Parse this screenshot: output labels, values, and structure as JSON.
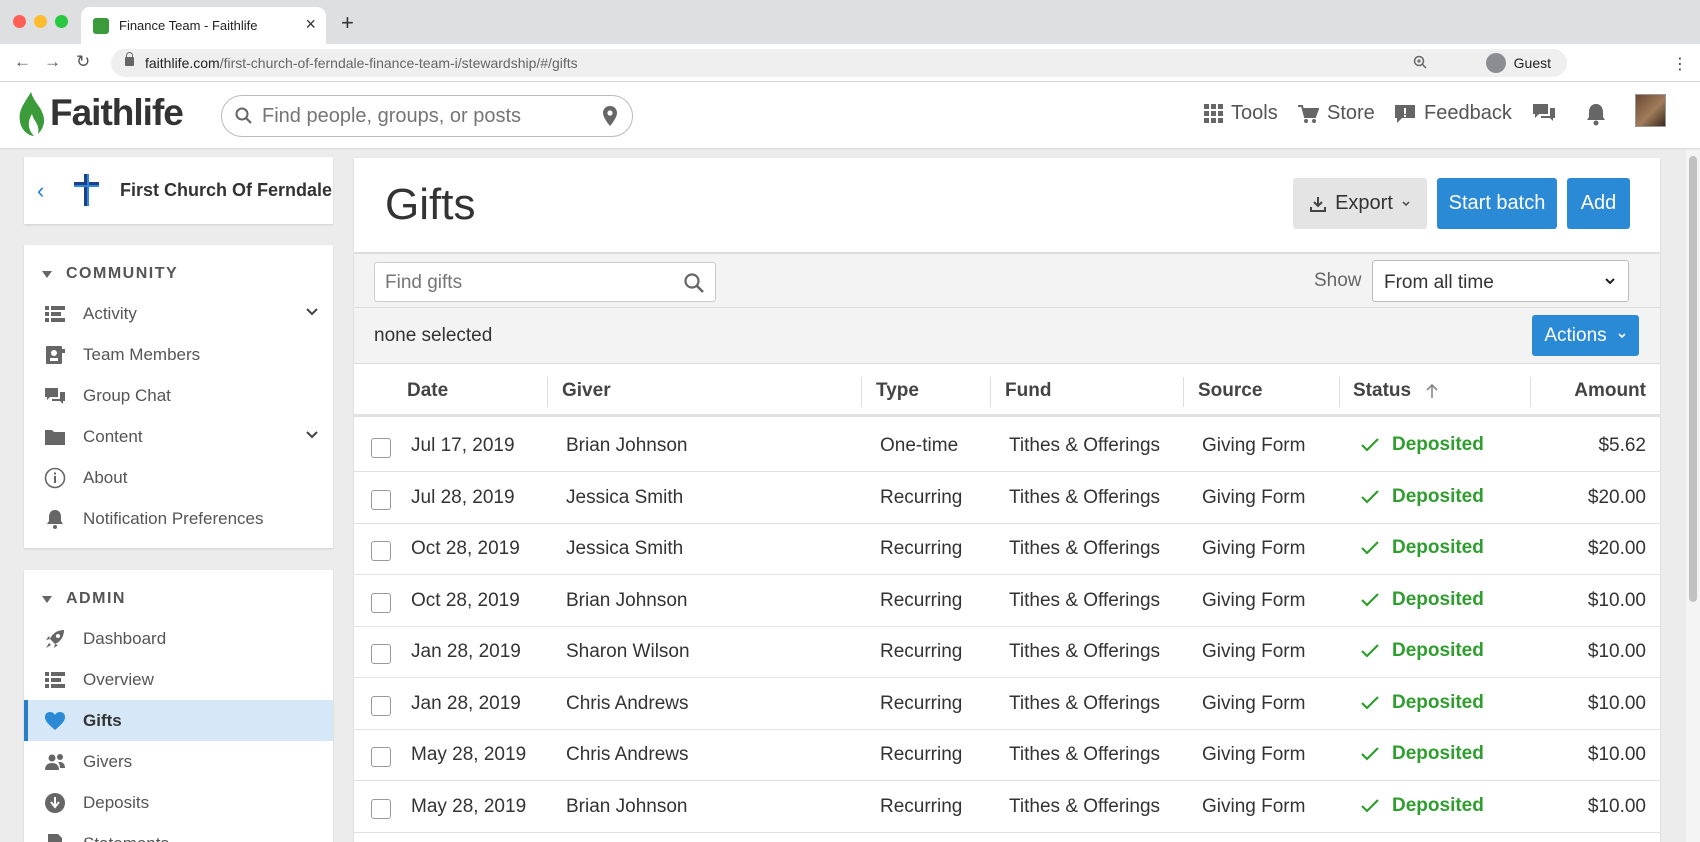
{
  "browser": {
    "tab_title": "Finance Team - Faithlife",
    "url_domain": "faithlife.com",
    "url_path": "/first-church-of-ferndale-finance-team-i/stewardship/#/gifts",
    "profile_label": "Guest"
  },
  "header": {
    "logo_text": "Faithlife",
    "search_placeholder": "Find people, groups, or posts",
    "tools_label": "Tools",
    "store_label": "Store",
    "feedback_label": "Feedback"
  },
  "sidebar": {
    "group_name": "First Church Of Ferndale",
    "community_heading": "COMMUNITY",
    "community_items": [
      {
        "label": "Activity",
        "icon": "list-icon",
        "expandable": true
      },
      {
        "label": "Team Members",
        "icon": "members-icon",
        "expandable": false
      },
      {
        "label": "Group Chat",
        "icon": "chat-icon",
        "expandable": false
      },
      {
        "label": "Content",
        "icon": "folder-icon",
        "expandable": true
      },
      {
        "label": "About",
        "icon": "info-icon",
        "expandable": false
      },
      {
        "label": "Notification Preferences",
        "icon": "bell-icon",
        "expandable": false
      }
    ],
    "admin_heading": "ADMIN",
    "admin_items": [
      {
        "label": "Dashboard",
        "icon": "rocket-icon"
      },
      {
        "label": "Overview",
        "icon": "list-icon"
      },
      {
        "label": "Gifts",
        "icon": "heart-icon",
        "active": true
      },
      {
        "label": "Givers",
        "icon": "people-icon"
      },
      {
        "label": "Deposits",
        "icon": "download-circle-icon"
      },
      {
        "label": "Statements",
        "icon": "document-icon"
      }
    ]
  },
  "main": {
    "title": "Gifts",
    "export_label": "Export",
    "start_batch_label": "Start batch",
    "add_label": "Add",
    "find_placeholder": "Find gifts",
    "show_label": "Show",
    "show_value": "From all time",
    "selection_text": "none selected",
    "actions_label": "Actions",
    "columns": [
      "Date",
      "Giver",
      "Type",
      "Fund",
      "Source",
      "Status",
      "Amount"
    ],
    "rows": [
      {
        "date": "Jul 17, 2019",
        "giver": "Brian Johnson",
        "type": "One-time",
        "fund": "Tithes & Offerings",
        "source": "Giving Form",
        "status": "Deposited",
        "amount": "$5.62"
      },
      {
        "date": "Jul 28, 2019",
        "giver": "Jessica Smith",
        "type": "Recurring",
        "fund": "Tithes & Offerings",
        "source": "Giving Form",
        "status": "Deposited",
        "amount": "$20.00"
      },
      {
        "date": "Oct 28, 2019",
        "giver": "Jessica Smith",
        "type": "Recurring",
        "fund": "Tithes & Offerings",
        "source": "Giving Form",
        "status": "Deposited",
        "amount": "$20.00"
      },
      {
        "date": "Oct 28, 2019",
        "giver": "Brian Johnson",
        "type": "Recurring",
        "fund": "Tithes & Offerings",
        "source": "Giving Form",
        "status": "Deposited",
        "amount": "$10.00"
      },
      {
        "date": "Jan 28, 2019",
        "giver": "Sharon Wilson",
        "type": "Recurring",
        "fund": "Tithes & Offerings",
        "source": "Giving Form",
        "status": "Deposited",
        "amount": "$10.00"
      },
      {
        "date": "Jan 28, 2019",
        "giver": "Chris Andrews",
        "type": "Recurring",
        "fund": "Tithes & Offerings",
        "source": "Giving Form",
        "status": "Deposited",
        "amount": "$10.00"
      },
      {
        "date": "May 28, 2019",
        "giver": "Chris Andrews",
        "type": "Recurring",
        "fund": "Tithes & Offerings",
        "source": "Giving Form",
        "status": "Deposited",
        "amount": "$10.00"
      },
      {
        "date": "May 28, 2019",
        "giver": "Brian Johnson",
        "type": "Recurring",
        "fund": "Tithes & Offerings",
        "source": "Giving Form",
        "status": "Deposited",
        "amount": "$10.00"
      }
    ]
  },
  "colors": {
    "brand_green": "#3b9b3b",
    "accent_blue": "#2a8ad6",
    "status_green": "#2f9e2f",
    "active_nav_bg": "#d6e8f7"
  }
}
